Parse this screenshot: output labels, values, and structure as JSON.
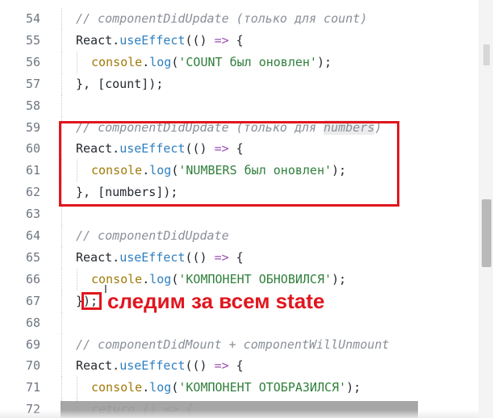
{
  "editor": {
    "colors": {
      "comment": "#8a8f98",
      "function": "#2f7fc0",
      "operator": "#9a4fb0",
      "string": "#2f7f3a",
      "console": "#a07a08",
      "text": "#24292f",
      "annotation": "#e0161e"
    },
    "lines": [
      {
        "num": "54",
        "indent": 0,
        "tokens": [
          [
            "com",
            "// componentDidUpdate (только для count)"
          ]
        ]
      },
      {
        "num": "55",
        "indent": 0,
        "tokens": [
          [
            "def",
            "React."
          ],
          [
            "fn",
            "useEffect"
          ],
          [
            "def",
            "(() "
          ],
          [
            "op",
            "=>"
          ],
          [
            "def",
            " {"
          ]
        ]
      },
      {
        "num": "56",
        "indent": 1,
        "tokens": [
          [
            "cons",
            "console"
          ],
          [
            "def",
            "."
          ],
          [
            "fn",
            "log"
          ],
          [
            "def",
            "("
          ],
          [
            "str",
            "'COUNT был оновлен'"
          ],
          [
            "def",
            ");"
          ]
        ]
      },
      {
        "num": "57",
        "indent": 0,
        "tokens": [
          [
            "def",
            "}, [count]);"
          ]
        ]
      },
      {
        "num": "58",
        "indent": 0,
        "tokens": []
      },
      {
        "num": "59",
        "indent": 0,
        "tokens": [
          [
            "com",
            "// componentDidUpdate (только для "
          ],
          [
            "com-hl",
            "numbers"
          ],
          [
            "com",
            ")"
          ]
        ]
      },
      {
        "num": "60",
        "indent": 0,
        "tokens": [
          [
            "def",
            "React."
          ],
          [
            "fn",
            "useEffect"
          ],
          [
            "def",
            "(() "
          ],
          [
            "op",
            "=>"
          ],
          [
            "def",
            " {"
          ]
        ]
      },
      {
        "num": "61",
        "indent": 1,
        "tokens": [
          [
            "cons",
            "console"
          ],
          [
            "def",
            "."
          ],
          [
            "fn",
            "log"
          ],
          [
            "def",
            "("
          ],
          [
            "str",
            "'NUMBERS был оновлен'"
          ],
          [
            "def",
            ");"
          ]
        ]
      },
      {
        "num": "62",
        "indent": 0,
        "tokens": [
          [
            "def",
            "}, [numbers]);"
          ]
        ]
      },
      {
        "num": "63",
        "indent": 0,
        "tokens": []
      },
      {
        "num": "64",
        "indent": 0,
        "tokens": [
          [
            "com",
            "// componentDidUpdate"
          ]
        ]
      },
      {
        "num": "65",
        "indent": 0,
        "tokens": [
          [
            "def",
            "React."
          ],
          [
            "fn",
            "useEffect"
          ],
          [
            "def",
            "(() "
          ],
          [
            "op",
            "=>"
          ],
          [
            "def",
            " {"
          ]
        ]
      },
      {
        "num": "66",
        "indent": 1,
        "tokens": [
          [
            "cons",
            "console"
          ],
          [
            "def",
            "."
          ],
          [
            "fn",
            "log"
          ],
          [
            "def",
            "("
          ],
          [
            "str",
            "'КОМПОНЕНТ ОБНОВИЛСЯ'"
          ],
          [
            "def",
            ");"
          ]
        ]
      },
      {
        "num": "67",
        "indent": 0,
        "tokens": [
          [
            "def",
            "});"
          ]
        ]
      },
      {
        "num": "68",
        "indent": 0,
        "tokens": []
      },
      {
        "num": "69",
        "indent": 0,
        "tokens": [
          [
            "com",
            "// componentDidMount + componentWillUnmount"
          ]
        ]
      },
      {
        "num": "70",
        "indent": 0,
        "tokens": [
          [
            "def",
            "React."
          ],
          [
            "fn",
            "useEffect"
          ],
          [
            "def",
            "(() "
          ],
          [
            "op",
            "=>"
          ],
          [
            "def",
            " {"
          ]
        ]
      },
      {
        "num": "71",
        "indent": 1,
        "tokens": [
          [
            "cons",
            "console"
          ],
          [
            "def",
            "."
          ],
          [
            "fn",
            "log"
          ],
          [
            "def",
            "("
          ],
          [
            "str",
            "'КОМПОНЕНТ ОТОБРАЗИЛСЯ'"
          ],
          [
            "def",
            ");"
          ]
        ]
      },
      {
        "num": "72",
        "indent": 1,
        "tokens": [
          [
            "com",
            "return () => {"
          ]
        ]
      }
    ]
  },
  "annotation": {
    "text": "следим за всем state"
  }
}
